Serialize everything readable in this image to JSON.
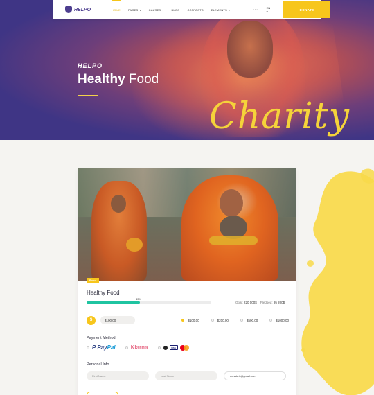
{
  "header": {
    "logo_text": "HELPO",
    "nav": [
      {
        "label": "HOME",
        "active": true,
        "caret": false
      },
      {
        "label": "PAGES",
        "active": false,
        "caret": true
      },
      {
        "label": "CAUSES",
        "active": false,
        "caret": true
      },
      {
        "label": "BLOG",
        "active": false,
        "caret": false
      },
      {
        "label": "CONTACTS",
        "active": false,
        "caret": false
      },
      {
        "label": "ELEMENTS",
        "active": false,
        "caret": true
      }
    ],
    "more": "···",
    "language": "EN",
    "donate_label": "DONATE",
    "accent_color": "#f7c61c"
  },
  "hero": {
    "brand": "HELPO",
    "title_bold": "Healthy",
    "title_light": "Food",
    "script_text": "Charity"
  },
  "campaign": {
    "badge": "Food",
    "title": "Healthy Food",
    "progress_percent": 43,
    "progress_label": "43%",
    "goal_label": "Goal:",
    "goal_value": "220 000$",
    "pledged_label": "Pledged:",
    "pledged_value": "95 200$",
    "progress_color": "#1fc4a1"
  },
  "donation": {
    "currency_symbol": "$",
    "amount_value": "$100.00",
    "presets": [
      {
        "label": "$100.00",
        "selected": true
      },
      {
        "label": "$200.00",
        "selected": false
      },
      {
        "label": "$500.00",
        "selected": false
      },
      {
        "label": "$1000.00",
        "selected": false
      }
    ]
  },
  "payment": {
    "title": "Payment Method",
    "paypal_a": "Pay",
    "paypal_b": "Pal",
    "paypal_mark": "P",
    "klarna": "Klarna",
    "visa": "VISA"
  },
  "personal": {
    "title": "Personal Info",
    "first_name_placeholder": "First Name",
    "last_name_placeholder": "Last Name",
    "email_value": "donate.it@gmail.com"
  }
}
